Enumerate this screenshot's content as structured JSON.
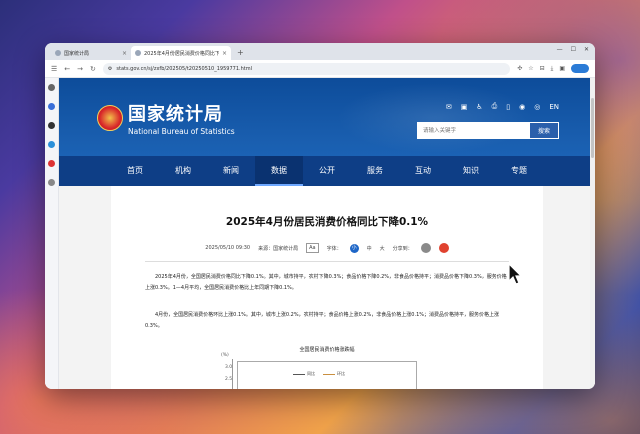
{
  "browser": {
    "tabs": [
      {
        "title": "国家统计局",
        "active": false
      },
      {
        "title": "2025年4月份居民消费价格同比下降0.1%",
        "active": true
      }
    ],
    "new_tab": "+",
    "url": "stats.gov.cn/sj/zxfb/202505/t20250510_1959771.html"
  },
  "site": {
    "logo_cn": "国家统计局",
    "logo_en": "National Bureau of Statistics",
    "lang": "EN",
    "search_placeholder": "请输入关键字",
    "search_button": "搜索",
    "nav": [
      {
        "label": "首页",
        "active": false
      },
      {
        "label": "机构",
        "active": false
      },
      {
        "label": "新闻",
        "active": false
      },
      {
        "label": "数据",
        "active": true
      },
      {
        "label": "公开",
        "active": false
      },
      {
        "label": "服务",
        "active": false
      },
      {
        "label": "互动",
        "active": false
      },
      {
        "label": "知识",
        "active": false
      },
      {
        "label": "专题",
        "active": false
      }
    ]
  },
  "article": {
    "title": "2025年4月份居民消费价格同比下降0.1%",
    "date": "2025/05/10 09:30",
    "source": "来源：国家统计局",
    "font_label": "字体：",
    "font_aa": "Aa",
    "font_small": "小",
    "font_medium": "中",
    "font_large": "大",
    "share_label": "分享到：",
    "para1": "2025年4月份，全国居民消费价格同比下降0.1%。其中，城市持平，农村下降0.3%；食品价格下降0.2%，非食品价格持平；消费品价格下降0.3%，服务价格上涨0.3%。1—4月平均，全国居民消费价格比上年同期下降0.1%。",
    "para2": "4月份，全国居民消费价格环比上涨0.1%。其中，城市上涨0.2%，农村持平；食品价格上涨0.2%，非食品价格上涨0.1%；消费品价格持平，服务价格上涨0.3%。",
    "chart_title": "全国居民消费价格涨跌幅",
    "chart_unit": "(%)",
    "chart_ticks": [
      "3.0",
      "2.5"
    ],
    "legend": [
      {
        "name": "同比",
        "color": "#555555"
      },
      {
        "name": "环比",
        "color": "#c98f3f"
      }
    ]
  }
}
